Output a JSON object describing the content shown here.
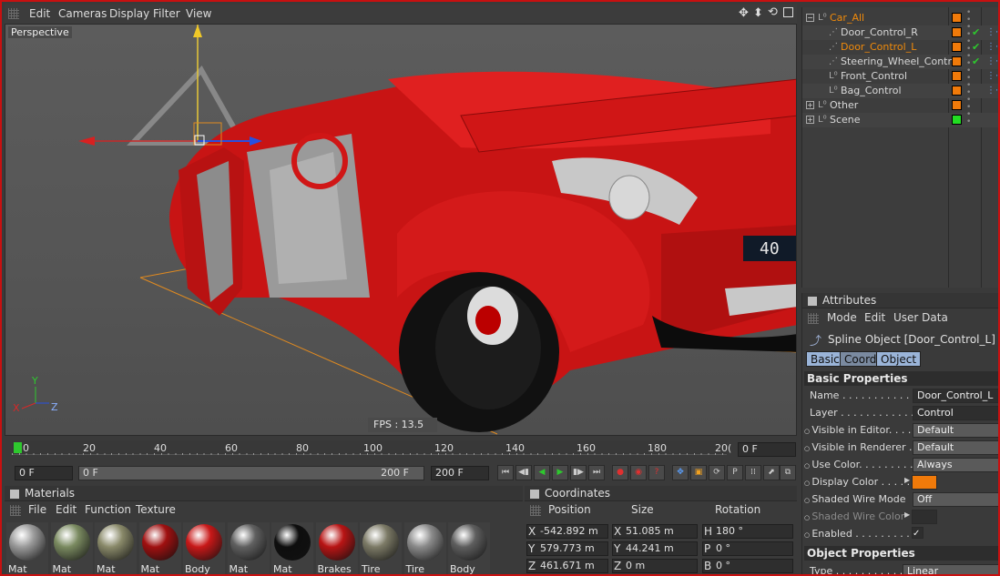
{
  "viewport": {
    "menu": [
      "Edit",
      "Cameras",
      "Display",
      "Filter",
      "View"
    ],
    "label": "Perspective",
    "fps": "FPS : 13.5",
    "axis": {
      "y": "Y",
      "x": "X",
      "z": "Z"
    },
    "plate": "40"
  },
  "timeline": {
    "ticks": [
      "0",
      "20",
      "40",
      "60",
      "80",
      "100",
      "120",
      "140",
      "160",
      "180",
      "20("
    ],
    "current_frame": "0 F",
    "start_field": "0 F",
    "range_start": "0 F",
    "range_end": "200 F",
    "end_field": "200 F"
  },
  "materials": {
    "title": "Materials",
    "menu": [
      "File",
      "Edit",
      "Function",
      "Texture"
    ],
    "items": [
      {
        "label": "Mat",
        "color": "#9a9a9a"
      },
      {
        "label": "Mat",
        "color": "#7a8a60"
      },
      {
        "label": "Mat",
        "color": "#8a8a6a"
      },
      {
        "label": "Mat",
        "color": "#a01010"
      },
      {
        "label": "Body",
        "color": "#c81818"
      },
      {
        "label": "Mat",
        "color": "#606060"
      },
      {
        "label": "Mat",
        "color": "#0e0e0e"
      },
      {
        "label": "Brakes",
        "color": "#b81414"
      },
      {
        "label": "Tire",
        "color": "#7c7a66"
      },
      {
        "label": "Tire",
        "color": "#8a8a8a"
      },
      {
        "label": "Body",
        "color": "#5e5e5e"
      }
    ]
  },
  "coordinates": {
    "title": "Coordinates",
    "headers": [
      "Position",
      "Size",
      "Rotation"
    ],
    "rows": [
      {
        "a": "X",
        "pos": "-542.892 m",
        "b": "X",
        "size": "51.085 m",
        "c": "H",
        "rot": "180 °"
      },
      {
        "a": "Y",
        "pos": "579.773 m",
        "b": "Y",
        "size": "44.241 m",
        "c": "P",
        "rot": "0 °"
      },
      {
        "a": "Z",
        "pos": "461.671 m",
        "b": "Z",
        "size": "0 m",
        "c": "B",
        "rot": "0 °"
      }
    ]
  },
  "objects": {
    "rows": [
      {
        "name": "Car_All",
        "color": "#f08a0a",
        "status": "#f07a0a",
        "check": false
      },
      {
        "name": "Door_Control_R",
        "color": "#d8d8d8",
        "status": "#f07a0a",
        "check": true
      },
      {
        "name": "Door_Control_L",
        "color": "#f08a0a",
        "status": "#f07a0a",
        "check": true
      },
      {
        "name": "Steering_Wheel_Control",
        "color": "#d8d8d8",
        "status": "#f07a0a",
        "check": true
      },
      {
        "name": "Front_Control",
        "color": "#d8d8d8",
        "status": "#f07a0a",
        "check": false
      },
      {
        "name": "Bag_Control",
        "color": "#d8d8d8",
        "status": "#f07a0a",
        "check": false
      },
      {
        "name": "Other",
        "color": "#d8d8d8",
        "status": "#f07a0a",
        "check": false
      },
      {
        "name": "Scene",
        "color": "#d8d8d8",
        "status": "#22dd22",
        "check": false
      }
    ]
  },
  "attributes": {
    "title": "Attributes",
    "menu": [
      "Mode",
      "Edit",
      "User Data"
    ],
    "object_title": "Spline Object [Door_Control_L]",
    "tabs": [
      "Basic",
      "Coord",
      "Object"
    ],
    "basic_title": "Basic Properties",
    "fields": [
      {
        "label": "Name . . . . . . . . . . . .",
        "value": "Door_Control_L"
      },
      {
        "label": "Layer . . . . . . . . . . . .",
        "value": "Control"
      },
      {
        "label": "Visible in Editor. . . . .",
        "value": "Default"
      },
      {
        "label": "Visible in Renderer . .",
        "value": "Default"
      },
      {
        "label": "Use Color. . . . . . . . .",
        "value": "Always"
      },
      {
        "label": "Display Color . . . . .",
        "value": ""
      },
      {
        "label": "Shaded Wire Mode",
        "value": "Off"
      },
      {
        "label": "Shaded Wire Color",
        "value": ""
      },
      {
        "label": "Enabled . . . . . . . . . .",
        "value": "✓"
      }
    ],
    "object_props_title": "Object Properties",
    "type_label": "Type . . . . . . . . . . . .",
    "type_value": "Linear",
    "display_color": "#f07a0a"
  }
}
